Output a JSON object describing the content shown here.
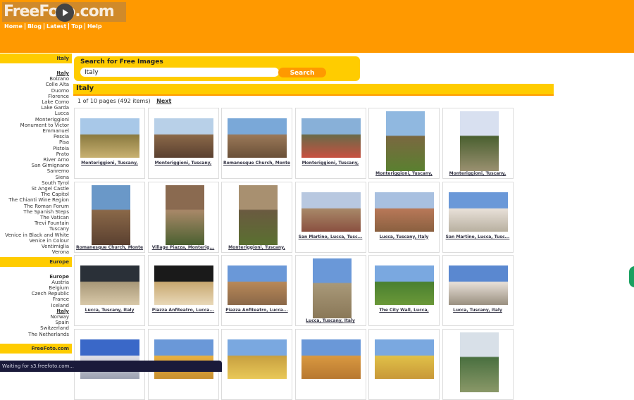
{
  "brand": {
    "logo_text": "FreeFoto.com"
  },
  "nav": [
    "Home",
    "Blog",
    "Latest",
    "Top",
    "Help"
  ],
  "sidebar": {
    "region_heading": "Italy",
    "region_items": [
      "Italy",
      "Bolzano",
      "Colle Alta",
      "Duomo",
      "Florence",
      "Lake Como",
      "Lake Garda",
      "Lucca",
      "Monteriggioni",
      "Monument to Victor Emmanuel",
      "Pescia",
      "Pisa",
      "Pistoia",
      "Prato",
      "River Arno",
      "San Gimignano",
      "Sanremo",
      "Siena",
      "South Tyrol",
      "St Angel Castle",
      "The Capitol",
      "The Chianti Wine Region",
      "The Roman Forum",
      "The Spanish Steps",
      "The Vatican",
      "Trevi Fountain",
      "Tuscany",
      "Venice in Black and White",
      "Venice in Colour",
      "Ventimiglia",
      "Verona"
    ],
    "europe_heading": "Europe",
    "europe_items": [
      "Europe",
      "Austria",
      "Belgium",
      "Czech Republic",
      "France",
      "Iceland",
      "Italy",
      "Norway",
      "Spain",
      "Switzerland",
      "The Netherlands"
    ],
    "footer": "FreeFoto.com"
  },
  "search": {
    "label": "Search for Free Images",
    "value": "Italy",
    "button": "Search"
  },
  "section": {
    "title": "Italy",
    "pages_text": "1 of 10 pages (492 items)",
    "next": "Next"
  },
  "photos": [
    {
      "caption": "Monteriggioni, Tuscany,",
      "colors": [
        "#a8c8e8",
        "#8a7a40",
        "#c8b070"
      ]
    },
    {
      "caption": "Monteriggioni, Tuscany,",
      "colors": [
        "#b8d0e8",
        "#8a6848",
        "#5a4030"
      ]
    },
    {
      "caption": "Romanesque Church, Monte...",
      "colors": [
        "#7aa8d8",
        "#9a7858",
        "#6a5038"
      ]
    },
    {
      "caption": "Monteriggioni, Tuscany,",
      "colors": [
        "#88b0d8",
        "#6a6a48",
        "#c85040"
      ]
    },
    {
      "caption": "Monteriggioni, Tuscany,",
      "colors": [
        "#90b8e0",
        "#7a6840",
        "#5a8030"
      ]
    },
    {
      "caption": "Monteriggioni, Tuscany,",
      "colors": [
        "#d8e0f0",
        "#4a6030",
        "#9a9070"
      ]
    },
    {
      "caption": "Romanesque Church, Monte...",
      "colors": [
        "#6a98c8",
        "#8a6848",
        "#5a4030"
      ]
    },
    {
      "caption": "Village Piazza, Monterig...",
      "colors": [
        "#8a6a50",
        "#a88868",
        "#4a6030"
      ]
    },
    {
      "caption": "Monteriggioni, Tuscany,",
      "colors": [
        "#a89070",
        "#6a5a40",
        "#5a7030"
      ]
    },
    {
      "caption": "San Martino, Lucca, Tusc...",
      "colors": [
        "#b8c8e0",
        "#a88868",
        "#8a5040"
      ]
    },
    {
      "caption": "Lucca, Tuscany, Italy",
      "colors": [
        "#a8c0e0",
        "#b87858",
        "#8a6040"
      ]
    },
    {
      "caption": "San Martino, Lucca, Tusc...",
      "colors": [
        "#6a98d8",
        "#e8e0d8",
        "#b8b0a0"
      ]
    },
    {
      "caption": "Lucca, Tuscany, Italy",
      "colors": [
        "#2a3038",
        "#a89878",
        "#d8c8a8"
      ]
    },
    {
      "caption": "Piazza Anfiteatro, Lucca...",
      "colors": [
        "#1a1a1a",
        "#c8a870",
        "#e8d8b8"
      ]
    },
    {
      "caption": "Piazza Anfiteatro, Lucca...",
      "colors": [
        "#6a98d8",
        "#b88858",
        "#8a6848"
      ]
    },
    {
      "caption": "Lucca, Tuscany, Italy",
      "colors": [
        "#6a98d8",
        "#a89878",
        "#8a7858"
      ]
    },
    {
      "caption": "The City Wall, Lucca,",
      "colors": [
        "#7aa8e0",
        "#4a8030",
        "#6a9838"
      ]
    },
    {
      "caption": "Lucca, Tuscany, Italy",
      "colors": [
        "#5a88d0",
        "#e8e0d8",
        "#9a9080"
      ]
    },
    {
      "caption": "",
      "colors": [
        "#3a68c8",
        "#e0e0e8",
        "#9aa0b0"
      ]
    },
    {
      "caption": "",
      "colors": [
        "#6a98d8",
        "#e8b040",
        "#c89030"
      ]
    },
    {
      "caption": "",
      "colors": [
        "#7aa8e0",
        "#c8a040",
        "#e8c858"
      ]
    },
    {
      "caption": "",
      "colors": [
        "#6a98d8",
        "#d89840",
        "#b87830"
      ]
    },
    {
      "caption": "",
      "colors": [
        "#7aa8e0",
        "#e0c048",
        "#c89838"
      ]
    },
    {
      "caption": "",
      "colors": [
        "#d8e0e8",
        "#4a7040",
        "#8a9868"
      ]
    }
  ],
  "status_bar": "Waiting for s3.freefoto.com..."
}
